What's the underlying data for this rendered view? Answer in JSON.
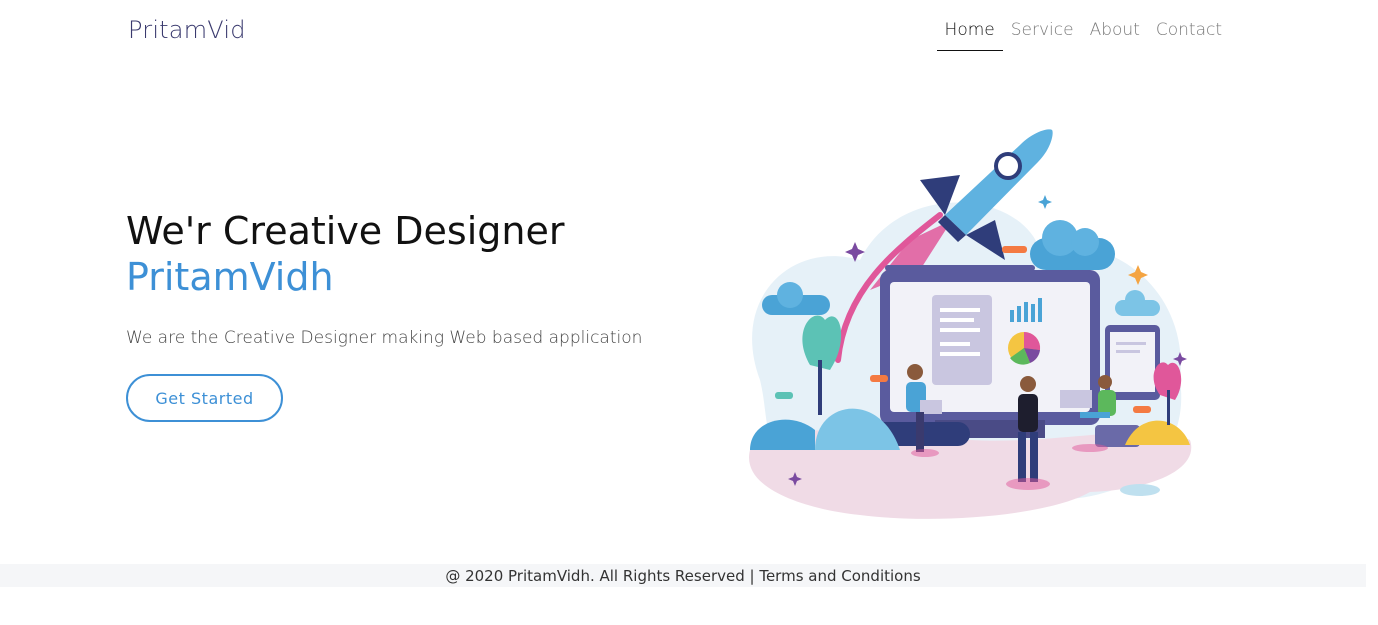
{
  "brand": "PritamVid",
  "nav": {
    "items": [
      {
        "label": "Home",
        "active": true
      },
      {
        "label": "Service",
        "active": false
      },
      {
        "label": "About",
        "active": false
      },
      {
        "label": "Contact",
        "active": false
      }
    ]
  },
  "hero": {
    "title": "We'r Creative Designer",
    "subtitle": "PritamVidh",
    "text": "We are the Creative Designer making Web based application",
    "cta_label": "Get Started"
  },
  "footer": {
    "copyright": "@ 2020 PritamVidh. All Rights Reserved",
    "separator": " | ",
    "terms": "Terms and Conditions"
  },
  "colors": {
    "accent": "#3d90d6",
    "brand": "#3a3a6e",
    "rocket_flame": "#e0579a"
  }
}
